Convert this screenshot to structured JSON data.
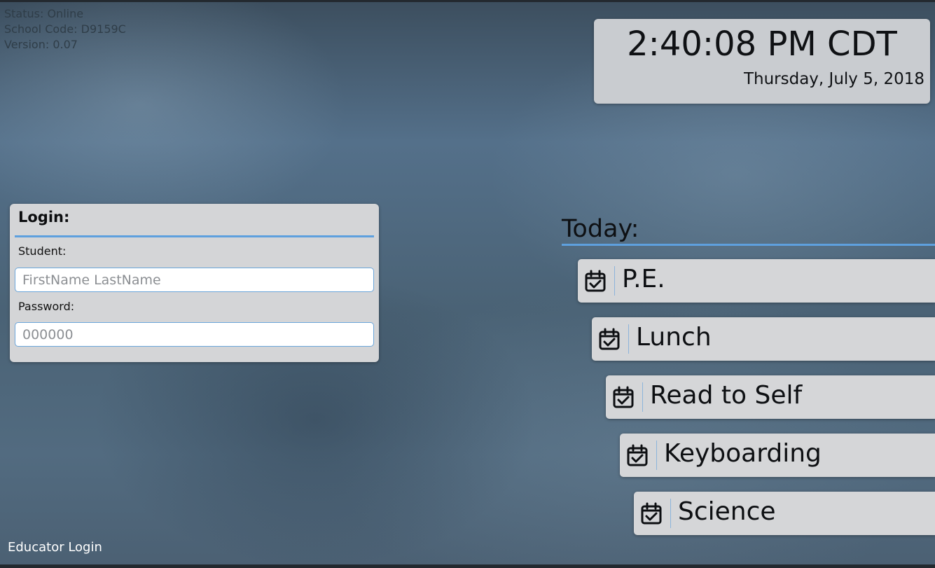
{
  "status": {
    "status_text": "Status: Online",
    "school_code_text": "School Code: D9159C",
    "version_text": "Version: 0.07"
  },
  "clock": {
    "time": "2:40:08 PM CDT",
    "date": "Thursday, July 5, 2018"
  },
  "login": {
    "title": "Login:",
    "student_label": "Student:",
    "student_placeholder": "FirstName LastName",
    "student_value": "",
    "password_label": "Password:",
    "password_placeholder": "000000",
    "password_value": ""
  },
  "today": {
    "heading": "Today:",
    "items": [
      {
        "label": "P.E.",
        "icon": "calendar-check-icon"
      },
      {
        "label": "Lunch",
        "icon": "calendar-check-icon"
      },
      {
        "label": "Read to Self",
        "icon": "calendar-check-icon"
      },
      {
        "label": "Keyboarding",
        "icon": "calendar-check-icon"
      },
      {
        "label": "Science",
        "icon": "calendar-check-icon"
      }
    ]
  },
  "footer": {
    "educator_login_label": "Educator Login"
  },
  "colors": {
    "accent": "#5ea0de",
    "card_background": "#d5d6d8",
    "background": "#4b6478"
  }
}
